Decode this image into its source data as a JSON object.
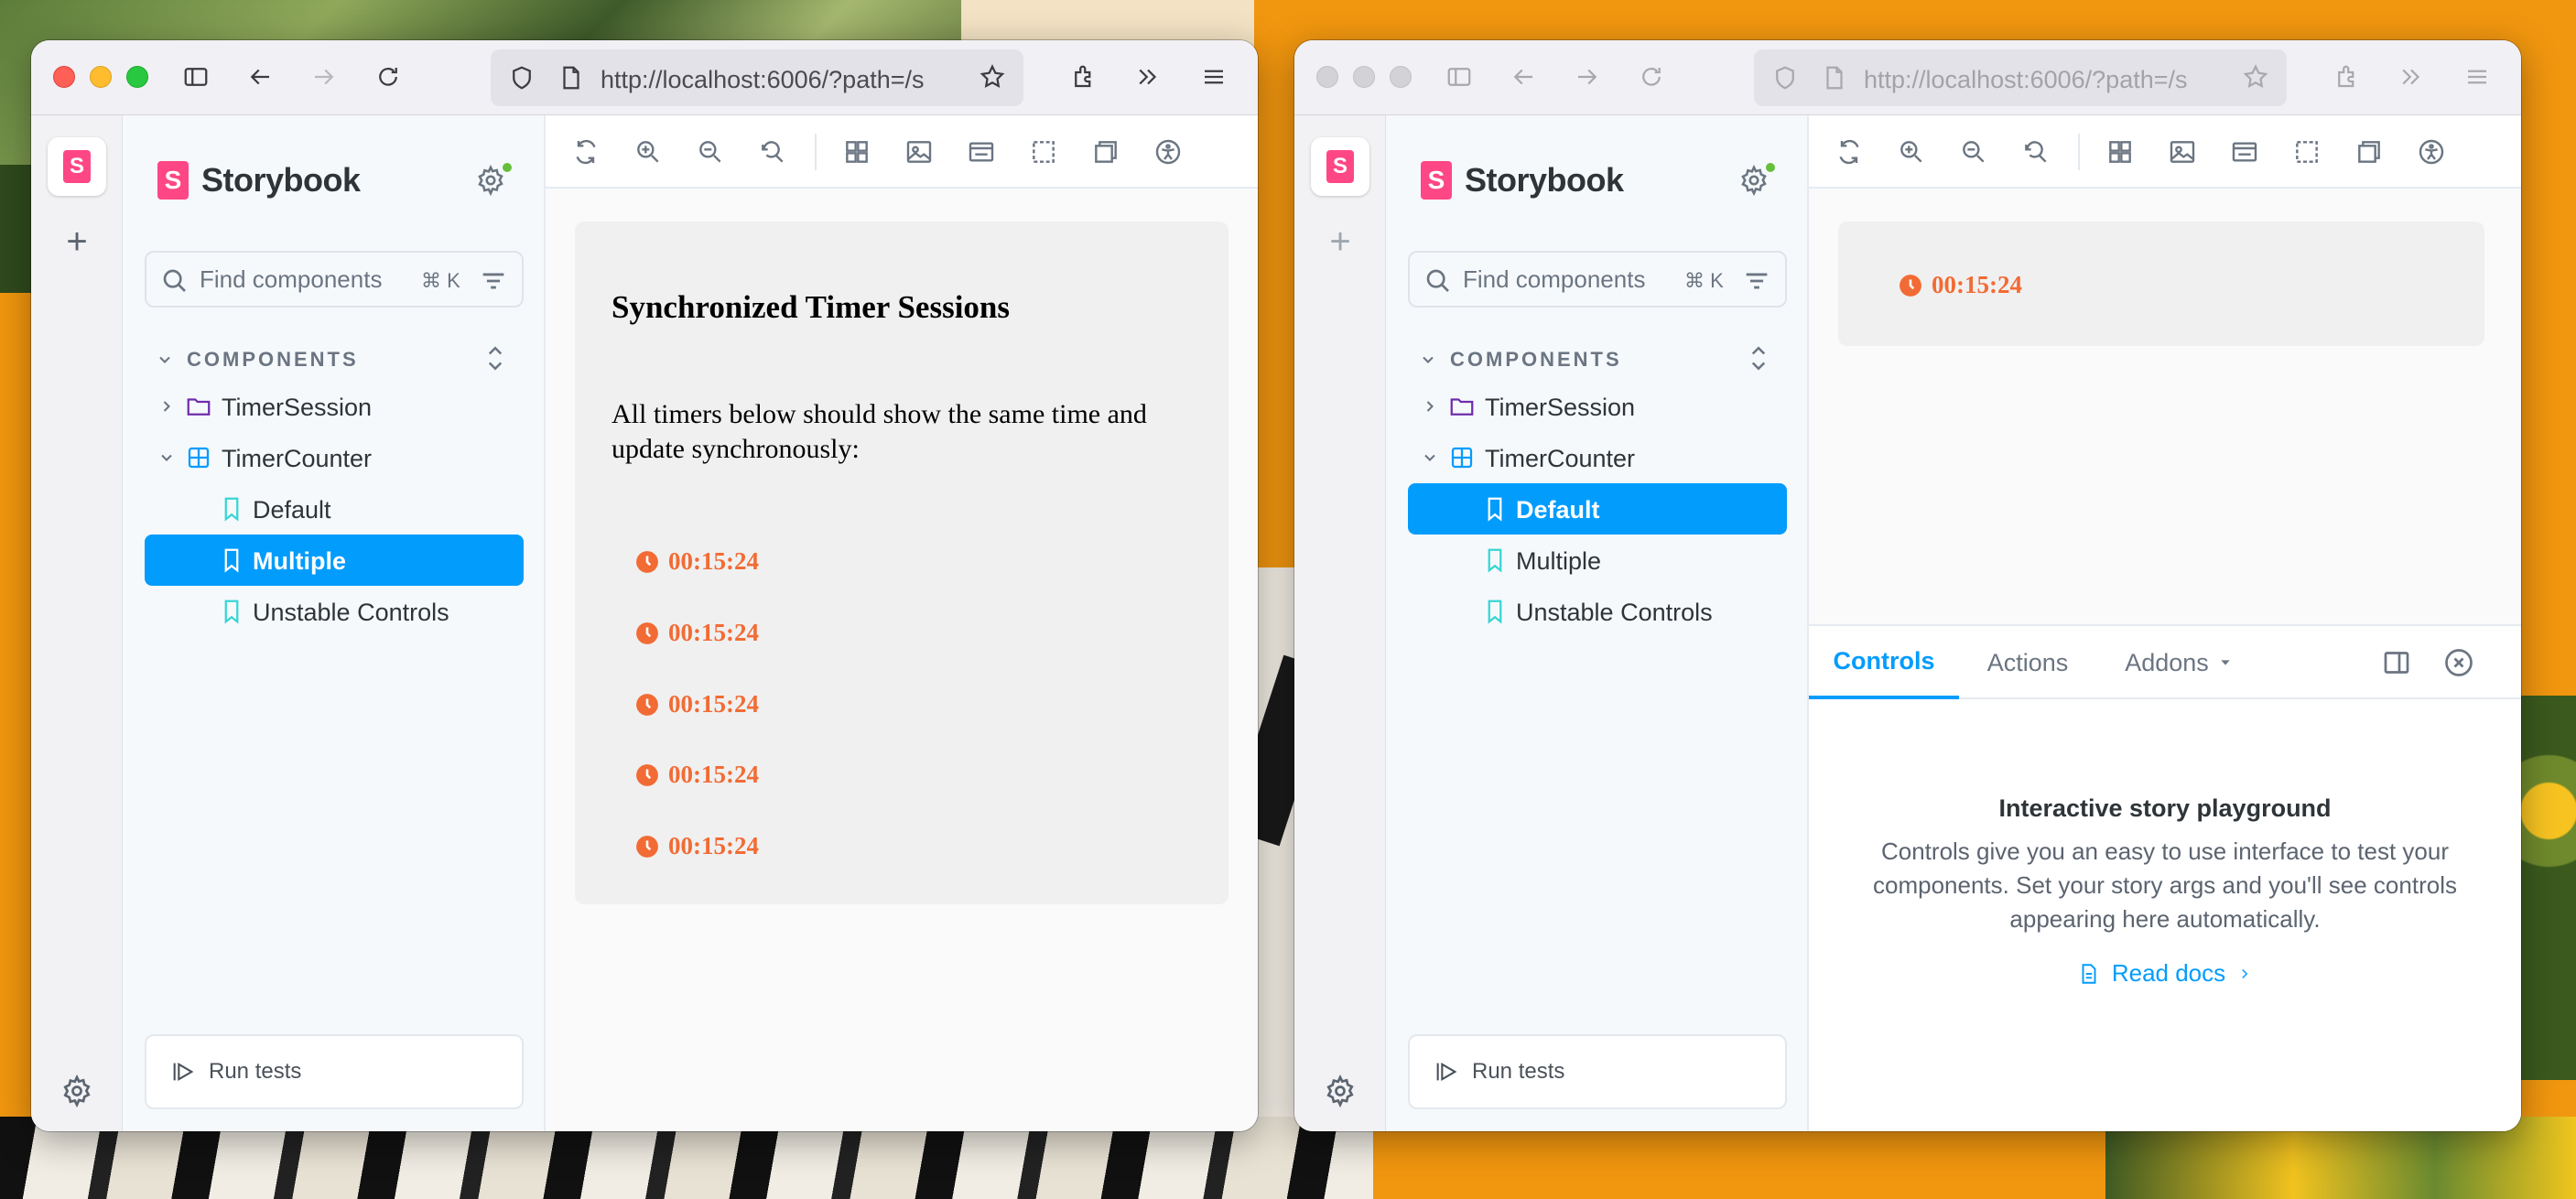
{
  "colors": {
    "storybook_pink": "#ff4785",
    "accent_blue": "#029cfd",
    "timer_orange": "#f26b34",
    "status_green": "#66bf3c"
  },
  "browser": {
    "url": "http://localhost:6006/?path=/s"
  },
  "storybook": {
    "brand": "Storybook",
    "brand_letter": "S",
    "search_placeholder": "Find components",
    "search_shortcut": "⌘ K",
    "section_label": "COMPONENTS",
    "run_tests": "Run tests"
  },
  "left_window": {
    "tree": [
      {
        "label": "TimerSession",
        "kind": "folder"
      },
      {
        "label": "TimerCounter",
        "kind": "component"
      },
      {
        "label": "Default",
        "kind": "story"
      },
      {
        "label": "Multiple",
        "kind": "story",
        "selected": true
      },
      {
        "label": "Unstable Controls",
        "kind": "story"
      }
    ],
    "story": {
      "title": "Synchronized Timer Sessions",
      "description": "All timers below should show the same time and update synchronously:",
      "timers": [
        "00:15:24",
        "00:15:24",
        "00:15:24",
        "00:15:24",
        "00:15:24"
      ]
    }
  },
  "right_window": {
    "tree": [
      {
        "label": "TimerSession",
        "kind": "folder"
      },
      {
        "label": "TimerCounter",
        "kind": "component"
      },
      {
        "label": "Default",
        "kind": "story",
        "selected": true
      },
      {
        "label": "Multiple",
        "kind": "story"
      },
      {
        "label": "Unstable Controls",
        "kind": "story"
      }
    ],
    "timer": "00:15:24",
    "addon_tabs": [
      {
        "label": "Controls",
        "active": true
      },
      {
        "label": "Actions"
      },
      {
        "label": "Addons",
        "dropdown": true
      }
    ],
    "empty_state": {
      "title": "Interactive story playground",
      "description": "Controls give you an easy to use interface to test your components. Set your story args and you'll see controls appearing here automatically.",
      "link": "Read docs"
    }
  },
  "icons": [
    "sidebar-toggle-icon",
    "back-arrow-icon",
    "forward-arrow-icon",
    "reload-icon",
    "shield-icon",
    "page-icon",
    "bookmark-star-icon",
    "extensions-icon",
    "overflow-icon",
    "menu-icon",
    "gear-icon",
    "search-icon",
    "filter-icon",
    "folder-icon",
    "component-icon",
    "bookmark-icon",
    "clock-icon",
    "document-icon",
    "close-icon"
  ]
}
